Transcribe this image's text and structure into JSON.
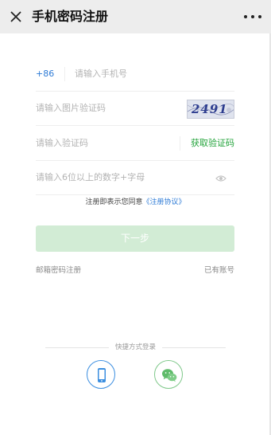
{
  "header": {
    "title": "手机密码注册"
  },
  "form": {
    "country_code": "+86",
    "phone_placeholder": "请输入手机号",
    "captcha_placeholder": "请输入图片验证码",
    "captcha_image_text": "2491",
    "sms_code_placeholder": "请输入验证码",
    "get_code_label": "获取验证码",
    "password_placeholder": "请输入6位以上的数字+字母"
  },
  "agreement": {
    "prefix": "注册即表示您同意",
    "link": "《注册协议》"
  },
  "actions": {
    "next_label": "下一步",
    "email_register": "邮箱密码注册",
    "have_account": "已有账号"
  },
  "quick_login": {
    "label": "快捷方式登录",
    "options": [
      {
        "icon": "phone-icon"
      },
      {
        "icon": "wechat-icon"
      }
    ]
  },
  "colors": {
    "accent_blue": "#2e7bd6",
    "accent_green": "#22a33a",
    "button_disabled": "#d2ecd5"
  }
}
